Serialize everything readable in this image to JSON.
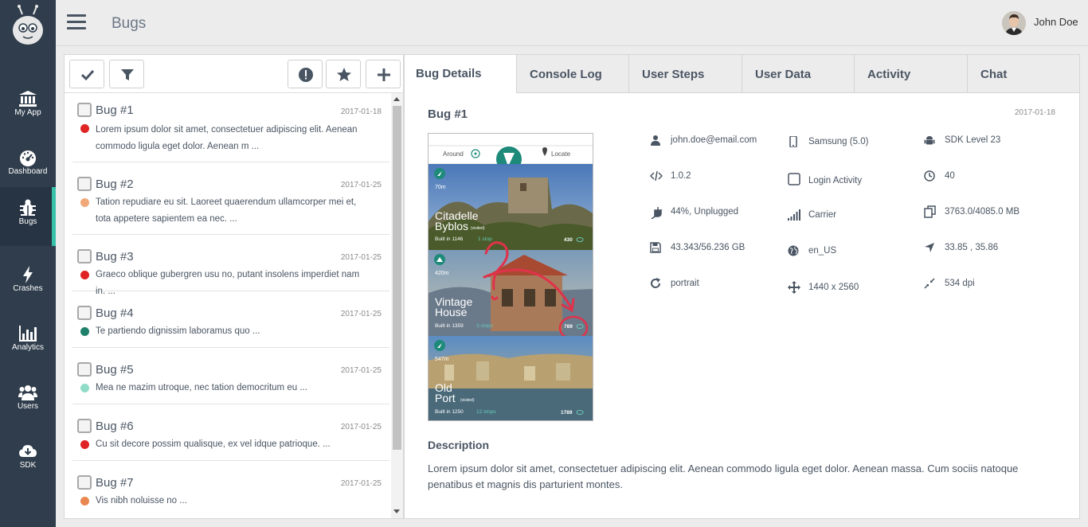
{
  "topbar": {
    "title": "Bugs",
    "user_name": "John Doe"
  },
  "sidebar": {
    "items": [
      {
        "label": "My App",
        "icon": "bank-icon"
      },
      {
        "label": "Dashboard",
        "icon": "gauge-icon"
      },
      {
        "label": "Bugs",
        "icon": "bug-icon",
        "active": true
      },
      {
        "label": "Crashes",
        "icon": "lightning-icon"
      },
      {
        "label": "Analytics",
        "icon": "bar-chart-icon"
      },
      {
        "label": "Users",
        "icon": "users-icon"
      },
      {
        "label": "SDK",
        "icon": "cloud-download-icon"
      }
    ]
  },
  "bugs": [
    {
      "name": "Bug #1",
      "date": "2017-01-18",
      "color": "#e02424",
      "desc": "Lorem ipsum dolor sit amet, consectetuer adipiscing elit. Aenean commodo ligula eget dolor. Aenean m ..."
    },
    {
      "name": "Bug #2",
      "date": "2017-01-25",
      "color": "#f0a878",
      "desc": "Tation repudiare eu sit. Laoreet quaerendum ullamcorper mei et, tota appetere sapientem ea nec. ..."
    },
    {
      "name": "Bug #3",
      "date": "2017-01-25",
      "color": "#e02424",
      "desc": "Graeco oblique gubergren usu no, putant insolens imperdiet nam in. ..."
    },
    {
      "name": "Bug #4",
      "date": "2017-01-25",
      "color": "#1e7f6a",
      "desc": "Te partiendo dignissim laboramus quo ..."
    },
    {
      "name": "Bug #5",
      "date": "2017-01-25",
      "color": "#8fdcc8",
      "desc": "Mea ne mazim utroque, nec tation democritum eu ..."
    },
    {
      "name": "Bug #6",
      "date": "2017-01-25",
      "color": "#e02424",
      "desc": "Cu sit decore possim qualisque, ex vel idque patrioque. ..."
    },
    {
      "name": "Bug #7",
      "date": "2017-01-25",
      "color": "#e8874f",
      "desc": "Vis nibh noluisse no ..."
    }
  ],
  "tabs": [
    "Bug Details",
    "Console Log",
    "User Steps",
    "User Data",
    "Activity",
    "Chat"
  ],
  "detail": {
    "title": "Bug #1",
    "date": "2017-01-18",
    "info": [
      {
        "icon": "user-icon",
        "text": "john.doe@email.com"
      },
      {
        "icon": "phone-icon",
        "text": "Samsung (5.0)"
      },
      {
        "icon": "android-icon",
        "text": "SDK Level 23"
      },
      {
        "icon": "code-icon",
        "text": "1.0.2"
      },
      {
        "icon": "checkbox-icon",
        "text": "Login Activity"
      },
      {
        "icon": "clock-icon",
        "text": "40"
      },
      {
        "icon": "plug-icon",
        "text": "44%, Unplugged"
      },
      {
        "icon": "signal-icon",
        "text": "Carrier"
      },
      {
        "icon": "copy-icon",
        "text": "3763.0/4085.0 MB"
      },
      {
        "icon": "save-icon",
        "text": "43.343/56.236 GB"
      },
      {
        "icon": "globe-icon",
        "text": "en_US"
      },
      {
        "icon": "location-arrow-icon",
        "text": "33.85 , 35.86"
      },
      {
        "icon": "rotate-icon",
        "text": "portrait"
      },
      {
        "icon": "move-icon",
        "text": "1440 x 2560"
      },
      {
        "icon": "compress-icon",
        "text": "534 dpi"
      }
    ],
    "description_title": "Description",
    "description": "Lorem ipsum dolor sit amet, consectetuer adipiscing elit. Aenean commodo ligula eget dolor. Aenean massa. Cum sociis natoque penatibus et magnis dis parturient montes."
  },
  "screenshot": {
    "header_left": "Around",
    "header_right": "Locate",
    "cards": [
      {
        "distance": "70m",
        "title1": "Citadelle",
        "title2": "Byblos",
        "tag": "(visited)",
        "built": "Built in 1146",
        "stops": "1 stop",
        "views": "430"
      },
      {
        "distance": "420m",
        "title1": "Vintage",
        "title2": "House",
        "tag": "",
        "built": "Built in 1359",
        "stops": "3 stops",
        "views": "789"
      },
      {
        "distance": "547m",
        "title1": "Old",
        "title2": "Port",
        "tag": "(visited)",
        "built": "Built in 1250",
        "stops": "12 stops",
        "views": "1789"
      }
    ]
  }
}
